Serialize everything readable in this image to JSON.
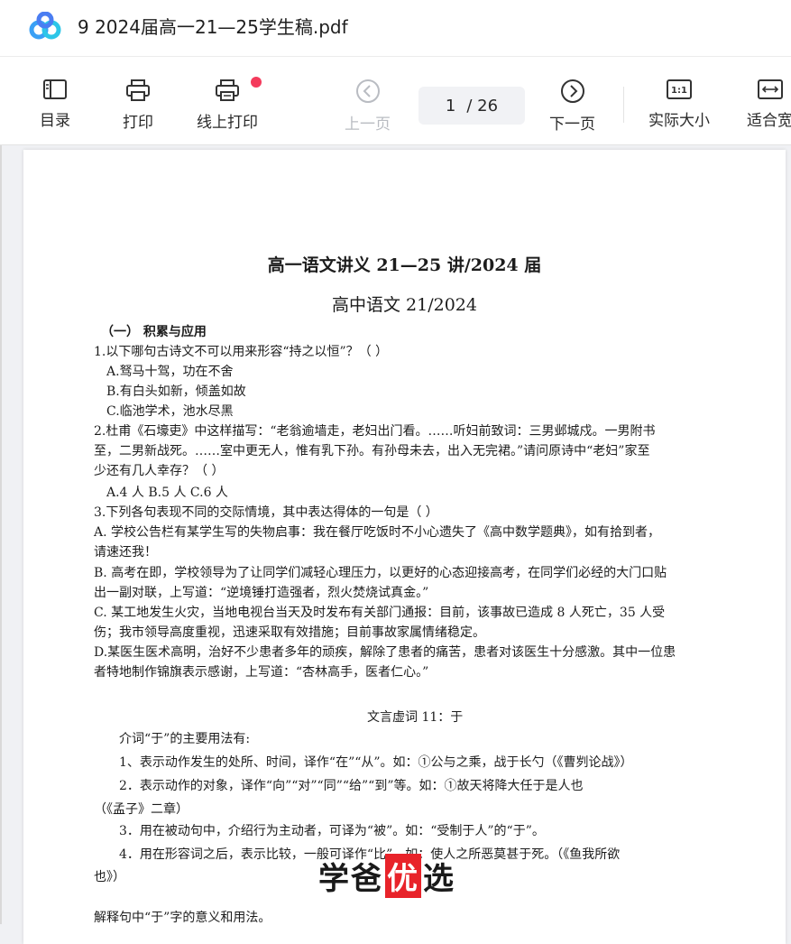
{
  "window": {
    "title": "9 2024届高一21—25学生稿.pdf"
  },
  "toolbar": {
    "toc_label": "目录",
    "print_label": "打印",
    "online_print_label": "线上打印",
    "prev_label": "上一页",
    "page_current": "1",
    "page_total": "/ 26",
    "next_label": "下一页",
    "actual_size_label": "实际大小",
    "fit_width_label": "适合宽",
    "colors": {
      "badge": "#f43b5c",
      "disabled": "#b9bcc2"
    }
  },
  "document": {
    "title": "高一语文讲义 21—25 讲/2024 届",
    "subtitle": "高中语文 21/2024",
    "section1": "（一）  积累与应用",
    "q1": "1.以下哪句古诗文不可以用来形容“持之以恒”？（      ）",
    "q1a": "A.驽马十驾，功在不舍",
    "q1b": "B.有白头如新，倾盖如故",
    "q1c": "C.临池学术，池水尽黑",
    "q2_l1": "2.杜甫《石壕吏》中这样描写：“老翁逾墙走，老妇出门看。……听妇前致词：三男邺城戍。一男附书",
    "q2_l2": "至，二男新战死。……室中更无人，惟有乳下孙。有孙母未去，出入无完裙。”请问原诗中“老妇”家至",
    "q2_l3": "少还有几人幸存？（      ）",
    "q2_opts": "A.4 人          B.5 人          C.6 人",
    "q3": "3.下列各句表现不同的交际情境，其中表达得体的一句是（      ）",
    "q3a_l1": "A. 学校公告栏有某学生写的失物启事：我在餐厅吃饭时不小心遗失了《高中数学题典》，如有拾到者，",
    "q3a_l2": "请速还我！",
    "q3b_l1": "B. 高考在即，学校领导为了让同学们减轻心理压力，以更好的心态迎接高考，在同学们必经的大门口贴",
    "q3b_l2": "出一副对联，上写道：“逆境锤打造强者，烈火焚烧试真金。”",
    "q3c_l1": "C. 某工地发生火灾，当地电视台当天及时发布有关部门通报：目前，该事故已造成 8 人死亡，35 人受",
    "q3c_l2": "伤；我市领导高度重视，迅速采取有效措施；目前事故家属情绪稳定。",
    "q3d_l1": "D.某医生医术高明，治好不少患者多年的顽疾，解除了患者的痛苦，患者对该医生十分感激。其中一位患",
    "q3d_l2": "者特地制作锦旗表示感谢，上写道：“杏林高手，医者仁心。”",
    "heading2": "文言虚词 11：于",
    "p1": "介词“于”的主要用法有:",
    "p2": "1、表示动作发生的处所、时间，译作“在”“从”。如：①公与之乘，战于长勺（《曹刿论战》）",
    "p3_l1": "2．表示动作的对象，译作“向”“对”“同”“给”“到”等。如：①故天将降大任于是人也",
    "p3_l2": "（《孟子》二章）",
    "p4": "3．用在被动句中，介绍行为主动者，可译为“被”。如：“受制于人”的“于”。",
    "p5_l1": "4．用在形容词之后，表示比较，一般可译作“比”。如：使人之所恶莫甚于死。（《鱼我所欲",
    "p5_l2": "也》）",
    "p6": "解释句中“于”字的意义和用法。"
  },
  "watermark": {
    "text1": "学爸",
    "text2": "优",
    "text3": "选"
  }
}
